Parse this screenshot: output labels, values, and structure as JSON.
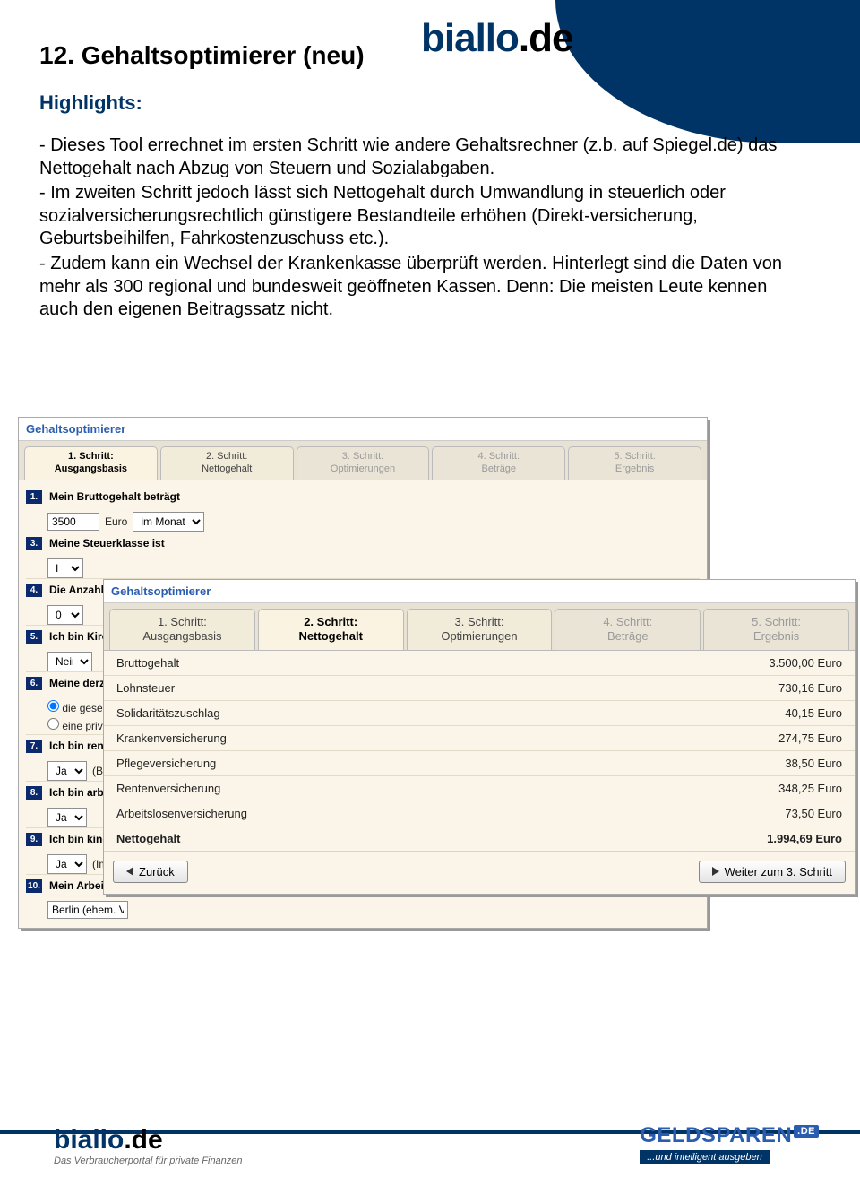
{
  "header": {
    "logo_biallo": "biallo",
    "logo_de": ".de"
  },
  "page": {
    "title": "12. Gehaltsoptimierer (neu)",
    "highlights_label": "Highlights:",
    "para1": "- Dieses Tool errechnet im ersten Schritt wie andere Gehaltsrechner (z.b. auf Spiegel.de) das Nettogehalt nach Abzug von Steuern und Sozialabgaben.",
    "para2": "- Im zweiten Schritt jedoch lässt sich Nettogehalt durch Umwandlung in steuerlich oder sozialversicherungsrechtlich günstigere Bestandteile erhöhen (Direkt-versicherung, Geburtsbeihilfen, Fahrkostenzuschuss etc.).",
    "para3": "- Zudem kann ein Wechsel der Krankenkasse überprüft werden. Hinterlegt sind die Daten von mehr als 300 regional und bundesweit geöffneten Kassen. Denn: Die meisten Leute kennen auch den eigenen Beitragssatz nicht."
  },
  "win1": {
    "title": "Gehaltsoptimierer",
    "tabs": [
      {
        "l1": "1. Schritt:",
        "l2": "Ausgangsbasis",
        "state": "active"
      },
      {
        "l1": "2. Schritt:",
        "l2": "Nettogehalt",
        "state": ""
      },
      {
        "l1": "3. Schritt:",
        "l2": "Optimierungen",
        "state": "disabled"
      },
      {
        "l1": "4. Schritt:",
        "l2": "Beträge",
        "state": "disabled"
      },
      {
        "l1": "5. Schritt:",
        "l2": "Ergebnis",
        "state": "disabled"
      }
    ],
    "q1": {
      "num": "1.",
      "label": "Mein Bruttogehalt beträgt",
      "value": "3500",
      "unit": "Euro",
      "period": "im Monat"
    },
    "q3": {
      "num": "3.",
      "label": "Meine Steuerklasse ist",
      "value": "I"
    },
    "q4": {
      "num": "4.",
      "label": "Die Anzahl meiner Kinderfreibeträge",
      "value": "0"
    },
    "q5": {
      "num": "5.",
      "label": "Ich bin Kirche",
      "value": "Nein"
    },
    "q6": {
      "num": "6.",
      "label": "Meine derzeit",
      "opt1": "die gese",
      "opt2": "eine priva"
    },
    "q7": {
      "num": "7.",
      "label": "Ich bin renten",
      "value": "Ja",
      "suffix": "(Be"
    },
    "q8": {
      "num": "8.",
      "label": "Ich bin arbeits",
      "value": "Ja"
    },
    "q9": {
      "num": "9.",
      "label": "Ich bin kinder",
      "value": "Ja",
      "suffix": "(Im"
    },
    "q10": {
      "num": "10.",
      "label": "Mein Arbeits",
      "value": "Berlin (ehem. V"
    }
  },
  "win2": {
    "title": "Gehaltsoptimierer",
    "tabs": [
      {
        "l1": "1. Schritt:",
        "l2": "Ausgangsbasis",
        "state": ""
      },
      {
        "l1": "2. Schritt:",
        "l2": "Nettogehalt",
        "state": "active"
      },
      {
        "l1": "3. Schritt:",
        "l2": "Optimierungen",
        "state": ""
      },
      {
        "l1": "4. Schritt:",
        "l2": "Beträge",
        "state": "disabled"
      },
      {
        "l1": "5. Schritt:",
        "l2": "Ergebnis",
        "state": "disabled"
      }
    ],
    "rows": [
      {
        "label": "Bruttogehalt",
        "value": "3.500,00 Euro",
        "bold": false
      },
      {
        "label": "Lohnsteuer",
        "value": "730,16 Euro",
        "bold": false
      },
      {
        "label": "Solidaritätszuschlag",
        "value": "40,15 Euro",
        "bold": false
      },
      {
        "label": "Krankenversicherung",
        "value": "274,75 Euro",
        "bold": false
      },
      {
        "label": "Pflegeversicherung",
        "value": "38,50 Euro",
        "bold": false
      },
      {
        "label": "Rentenversicherung",
        "value": "348,25 Euro",
        "bold": false
      },
      {
        "label": "Arbeitslosenversicherung",
        "value": "73,50 Euro",
        "bold": false
      },
      {
        "label": "Nettogehalt",
        "value": "1.994,69 Euro",
        "bold": true
      }
    ],
    "back": "Zurück",
    "next": "Weiter zum 3. Schritt"
  },
  "footer": {
    "biallo": "biallo",
    "de": ".de",
    "tag_left": "Das Verbraucherportal für private Finanzen",
    "geldsparen": "GELDSPAREN",
    "de2": ".DE",
    "tag_right": "...und intelligent ausgeben"
  }
}
